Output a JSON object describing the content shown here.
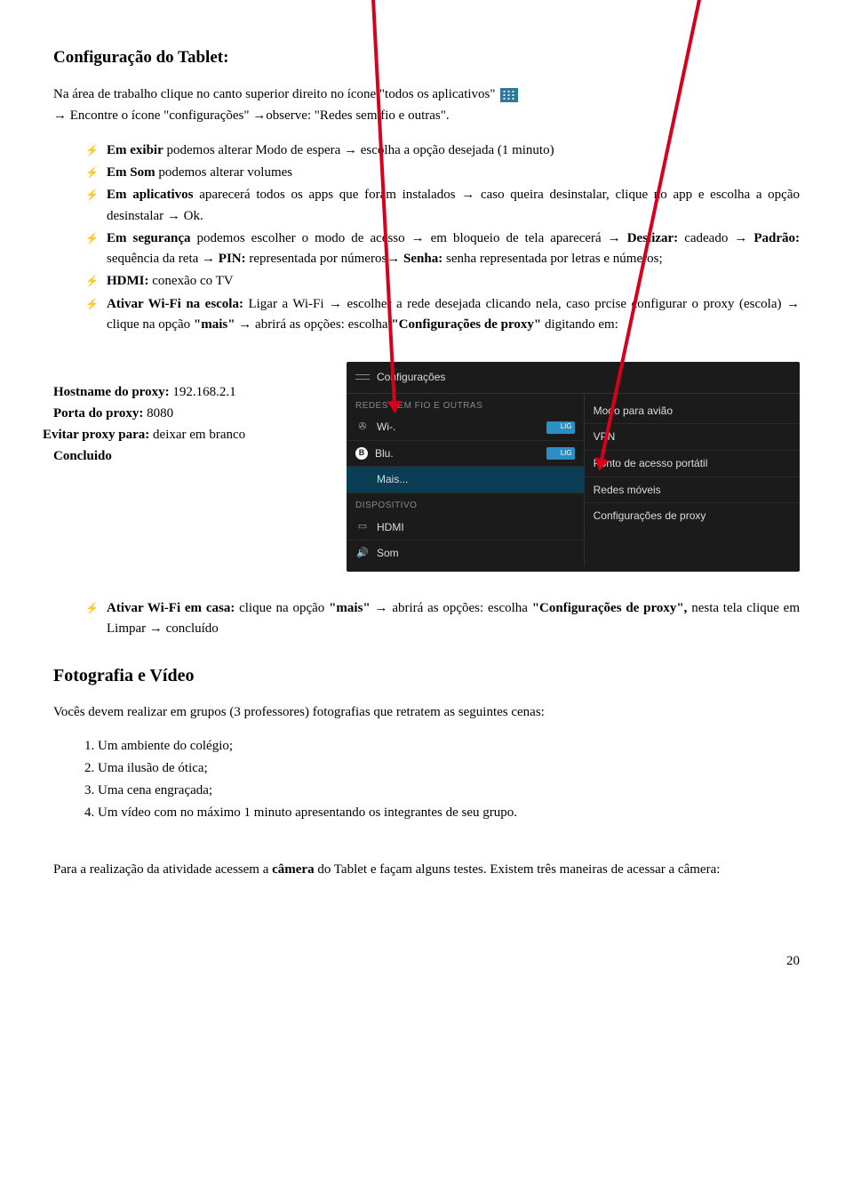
{
  "doc": {
    "title": "Configuração do Tablet:",
    "intro_part1": "Na área de trabalho clique no canto superior direito no ícone \"todos os aplicativos\"",
    "intro_part2": "→ Encontre o ícone \"configurações\" →observe:  \"Redes sem fio e outras\".",
    "bullets": [
      {
        "html": "<b>Em exibir</b> podemos alterar Modo de espera → escolha a opção desejada (1 minuto)"
      },
      {
        "html": "<b>Em Som</b> podemos alterar volumes"
      },
      {
        "html": "<b>Em aplicativos</b> aparecerá todos os apps que foram instalados → caso queira desinstalar, clique no app e escolha a opção desinstalar → Ok."
      },
      {
        "html": "<b>Em segurança</b> podemos escolher o modo de acesso → em bloqueio de tela aparecerá → <b>Deslizar:</b> cadeado → <b>Padrão:</b> sequência da reta → <b>PIN:</b> representada por números→  <b>Senha:</b> senha representada por letras e números;"
      },
      {
        "html": "<b>HDMI:</b> conexão co TV"
      },
      {
        "html": "<b>Ativar Wi-Fi na escola:</b> Ligar a Wi-Fi → escolher a rede desejada clicando nela, caso prcise configurar o proxy (escola) → clique na opção <b>\"mais\"</b> → abrirá as opções: escolha <b>\"Configurações de proxy\"</b> digitando em:"
      }
    ],
    "proxy": {
      "hostname_label": "Hostname do proxy:",
      "hostname_value": "192.168.2.1",
      "port_label": "Porta do proxy:",
      "port_value": "8080",
      "avoid_label": "Evitar proxy para:",
      "avoid_value": "deixar em branco",
      "done": "Concluido"
    },
    "screenshot": {
      "header": "Configurações",
      "left_cat1": "REDES SEM FIO E OUTRAS",
      "wifi": "Wi-.",
      "wifi_state": "LIG",
      "bt": "Blu.",
      "bt_state": "LIG",
      "more": "Mais...",
      "left_cat2": "DISPOSITIVO",
      "hdmi": "HDMI",
      "som": "Som",
      "right": {
        "airplane": "Modo para avião",
        "vpn": "VPN",
        "hotspot": "Ponto de acesso portátil",
        "mobile": "Redes móveis",
        "proxy": "Configurações de proxy"
      }
    },
    "bullets2": [
      {
        "html": "<b>Ativar Wi-Fi em casa:</b> clique na opção <b>\"mais\"</b> → abrirá as opções: escolha <b>\"Configurações de proxy\",</b> nesta tela clique em Limpar → concluído"
      }
    ],
    "section2_title": "Fotografia e Vídeo",
    "section2_intro": "Vocês devem realizar em grupos (3 professores) fotografias que retratem as seguintes cenas:",
    "ol": [
      "Um ambiente do colégio;",
      "Uma ilusão de ótica;",
      "Uma cena engraçada;",
      "Um vídeo com no máximo 1 minuto apresentando os integrantes de seu grupo."
    ],
    "closing_html": "Para a realização da atividade acessem a <b>câmera</b> do Tablet e façam alguns testes. Existem três maneiras de acessar a câmera:",
    "page_num": "20"
  }
}
